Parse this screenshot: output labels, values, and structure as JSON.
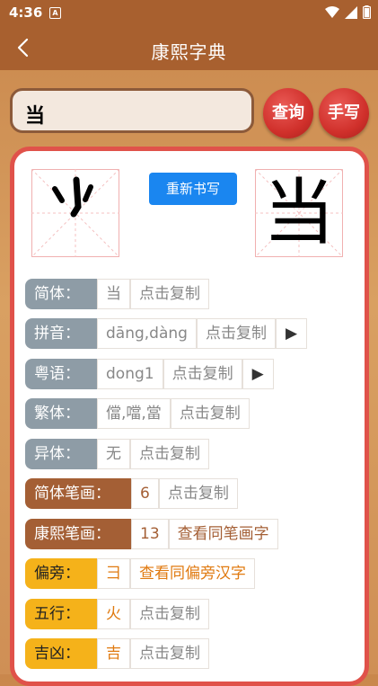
{
  "status_bar": {
    "time": "4:36",
    "notification_badge": "A"
  },
  "app_bar": {
    "title": "康熙字典"
  },
  "search": {
    "value": "当",
    "query_button": "查询",
    "handwrite_button": "手写"
  },
  "card": {
    "handwritten_glyph": "​",
    "rewrite_button": "重新书写",
    "result_glyph": "当",
    "rows": [
      {
        "label": "简体：",
        "value": "当",
        "action": "点击复制",
        "style": "gray"
      },
      {
        "label": "拼音：",
        "value": "dāng,dàng",
        "action": "点击复制",
        "play": "▶",
        "style": "gray"
      },
      {
        "label": "粤语：",
        "value": "dong1",
        "action": "点击复制",
        "play": "▶",
        "style": "gray"
      },
      {
        "label": "繁体：",
        "value": "儅,噹,當",
        "action": "点击复制",
        "style": "gray"
      },
      {
        "label": "异体：",
        "value": "无",
        "action": "点击复制",
        "style": "gray"
      },
      {
        "label": "简体笔画：",
        "value": "6",
        "action": "点击复制",
        "style": "brown"
      },
      {
        "label": "康熙笔画：",
        "value": "13",
        "action": "查看同笔画字",
        "style": "brown"
      },
      {
        "label": "偏旁：",
        "value": "彐",
        "action": "查看同偏旁汉字",
        "style": "yellow"
      },
      {
        "label": "五行：",
        "value": "火",
        "action": "点击复制",
        "style": "yellow"
      },
      {
        "label": "吉凶：",
        "value": "吉",
        "action": "点击复制",
        "style": "yellow"
      }
    ]
  }
}
